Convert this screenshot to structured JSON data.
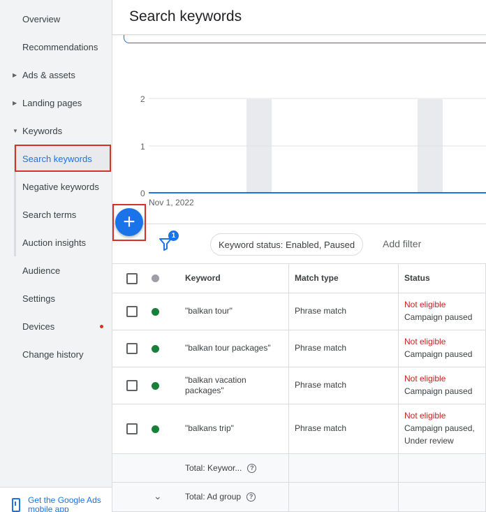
{
  "sidebar": {
    "items": [
      {
        "label": "Overview"
      },
      {
        "label": "Recommendations"
      },
      {
        "label": "Ads & assets"
      },
      {
        "label": "Landing pages"
      },
      {
        "label": "Keywords"
      },
      {
        "label": "Search keywords"
      },
      {
        "label": "Negative keywords"
      },
      {
        "label": "Search terms"
      },
      {
        "label": "Auction insights"
      },
      {
        "label": "Audience"
      },
      {
        "label": "Settings"
      },
      {
        "label": "Devices"
      },
      {
        "label": "Change history"
      }
    ],
    "promo": "Get the Google Ads mobile app"
  },
  "header": {
    "title": "Search keywords"
  },
  "chart_data": {
    "type": "line",
    "x": [
      "Nov 1, 2022"
    ],
    "y_ticks": [
      "2",
      "1",
      "0"
    ],
    "ylim": [
      0,
      2
    ],
    "series": [
      {
        "values": [
          0,
          0,
          0,
          0,
          0,
          0,
          0,
          0
        ]
      }
    ],
    "colors": {
      "line": "#1a73e8",
      "band": "#e8eaed"
    }
  },
  "filter": {
    "badge": "1",
    "chip": "Keyword status: Enabled, Paused",
    "add_filter": "Add filter"
  },
  "table": {
    "headers": {
      "keyword": "Keyword",
      "match_type": "Match type",
      "status": "Status"
    },
    "rows": [
      {
        "keyword": "\"balkan tour\"",
        "match_type": "Phrase match",
        "status_line1": "Not eligible",
        "status_line2": "Campaign paused",
        "status_line3": ""
      },
      {
        "keyword": "\"balkan tour packages\"",
        "match_type": "Phrase match",
        "status_line1": "Not eligible",
        "status_line2": "Campaign paused",
        "status_line3": ""
      },
      {
        "keyword": "\"balkan vacation packages\"",
        "match_type": "Phrase match",
        "status_line1": "Not eligible",
        "status_line2": "Campaign paused",
        "status_line3": ""
      },
      {
        "keyword": "\"balkans trip\"",
        "match_type": "Phrase match",
        "status_line1": "Not eligible",
        "status_line2": "Campaign paused,",
        "status_line3": "Under review"
      }
    ],
    "totals": [
      {
        "label": "Total: Keywor..."
      },
      {
        "label": "Total: Ad group"
      }
    ]
  }
}
